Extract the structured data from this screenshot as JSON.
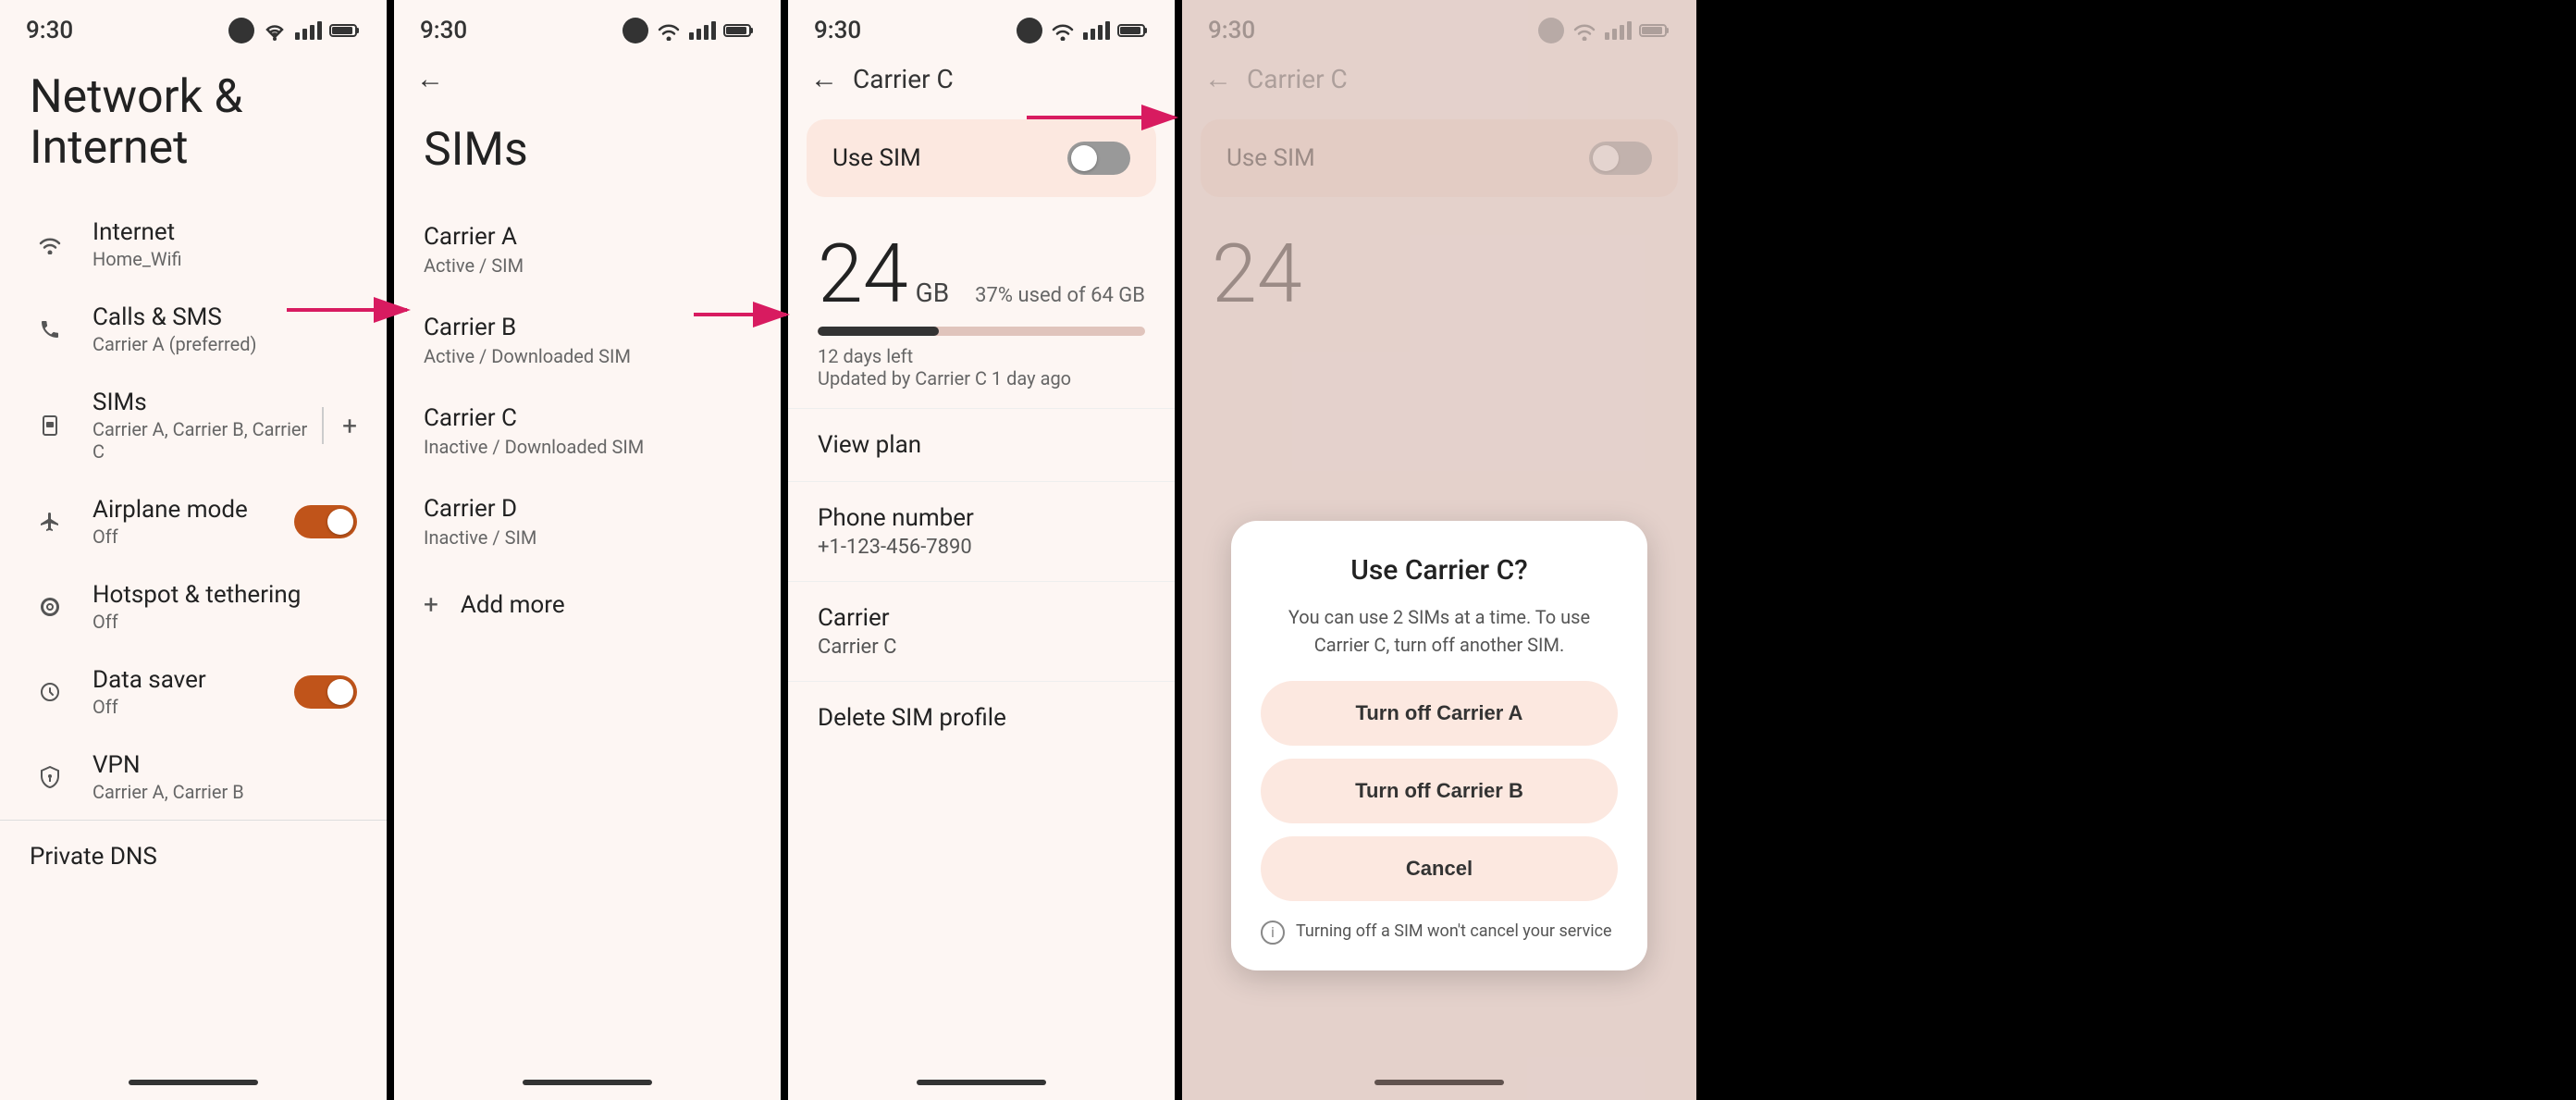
{
  "screen1": {
    "statusTime": "9:30",
    "title": "Network & Internet",
    "menuItems": [
      {
        "icon": "wifi",
        "label": "Internet",
        "sublabel": "Home_Wifi"
      },
      {
        "icon": "phone",
        "label": "Calls & SMS",
        "sublabel": "Carrier A (preferred)"
      },
      {
        "icon": "sim",
        "label": "SIMs",
        "sublabel": "Carrier A, Carrier B, Carrier C",
        "hasPlus": true
      },
      {
        "icon": "airplane",
        "label": "Airplane mode",
        "sublabel": "Off",
        "hasToggle": true,
        "toggleOn": true
      },
      {
        "icon": "hotspot",
        "label": "Hotspot & tethering",
        "sublabel": "Off"
      },
      {
        "icon": "datasaver",
        "label": "Data saver",
        "sublabel": "Off",
        "hasToggle": true,
        "toggleOn": true
      },
      {
        "icon": "vpn",
        "label": "VPN",
        "sublabel": "Carrier A, Carrier B"
      }
    ],
    "privateDns": "Private DNS",
    "bottomBarColor": "#333"
  },
  "screen2": {
    "statusTime": "9:30",
    "title": "SIMs",
    "carriers": [
      {
        "name": "Carrier A",
        "status": "Active / SIM"
      },
      {
        "name": "Carrier B",
        "status": "Active / Downloaded SIM"
      },
      {
        "name": "Carrier C",
        "status": "Inactive / Downloaded SIM"
      },
      {
        "name": "Carrier D",
        "status": "Inactive / SIM"
      }
    ],
    "addMore": "Add more"
  },
  "screen3": {
    "statusTime": "9:30",
    "navTitle": "Carrier C",
    "useSim": "Use SIM",
    "dataNumber": "24",
    "dataUnit": "GB",
    "dataPercent": "37% used of 64 GB",
    "daysLeft": "12 days left",
    "updatedBy": "Updated by Carrier C 1 day ago",
    "barFillPercent": 37,
    "viewPlan": "View plan",
    "phoneNumberLabel": "Phone number",
    "phoneNumberValue": "+1-123-456-7890",
    "carrierLabel": "Carrier",
    "carrierValue": "Carrier C",
    "deleteProfile": "Delete SIM profile"
  },
  "screen4": {
    "statusTime": "9:30",
    "navTitle": "Carrier C",
    "useSim": "Use SIM",
    "dataNumber": "24",
    "dialog": {
      "title": "Use Carrier C?",
      "body": "You can use 2 SIMs at a time. To use Carrier C, turn off another SIM.",
      "btn1": "Turn off Carrier A",
      "btn2": "Turn off Carrier B",
      "btn3": "Cancel",
      "footer": "Turning off a SIM won't cancel your service"
    }
  }
}
